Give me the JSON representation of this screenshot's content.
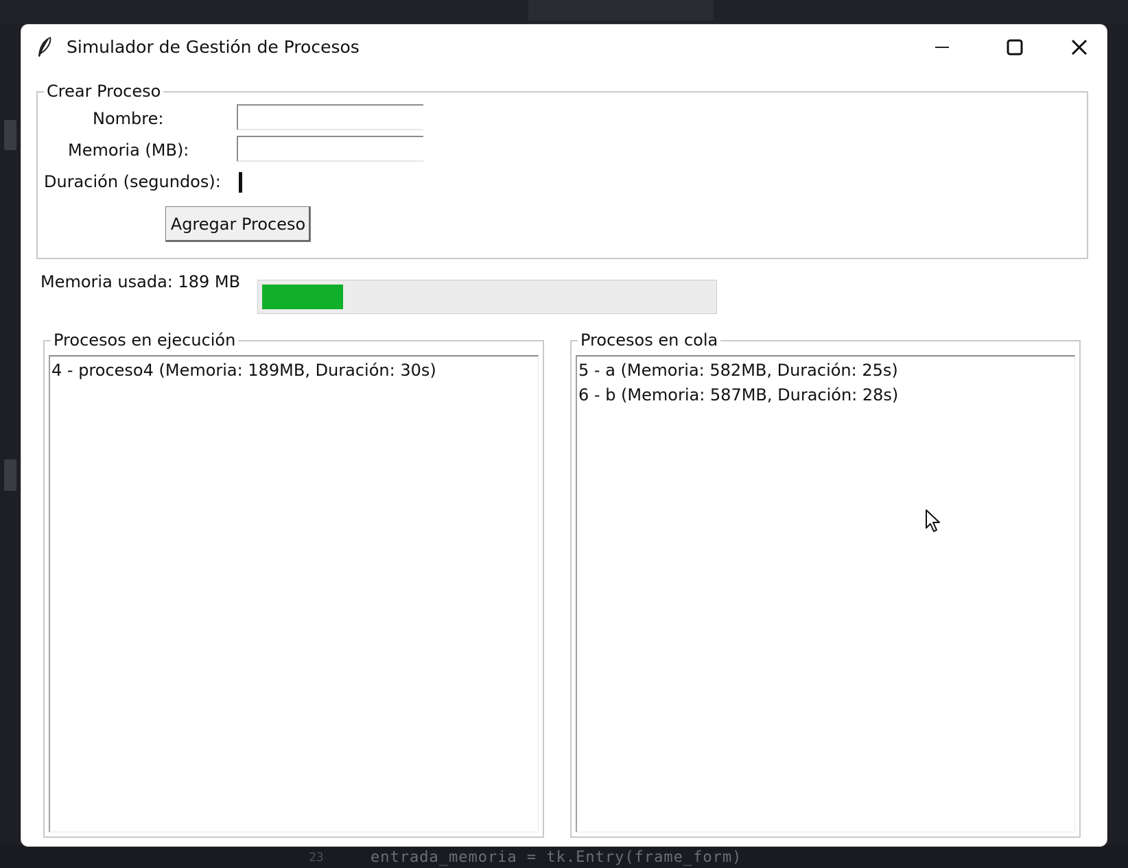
{
  "window": {
    "title": "Simulador de Gestión de Procesos",
    "icon": "feather-icon"
  },
  "form": {
    "frame_title": "Crear Proceso",
    "nombre_label": "Nombre:",
    "nombre_value": "",
    "memoria_label": "Memoria (MB):",
    "memoria_value": "",
    "duracion_label": "Duración (segundos):",
    "duracion_value": "",
    "add_button_label": "Agregar Proceso"
  },
  "memory": {
    "label": "Memoria usada: 189 MB",
    "used_mb": 189,
    "bar_fill_fraction": 0.18,
    "bar_color": "#10b02a"
  },
  "running": {
    "frame_title": "Procesos en ejecución",
    "items": [
      "4 - proceso4 (Memoria: 189MB, Duración: 30s)"
    ]
  },
  "queue": {
    "frame_title": "Procesos en cola",
    "items": [
      "5 - a (Memoria: 582MB, Duración: 25s)",
      "6 - b (Memoria: 587MB, Duración: 28s)"
    ]
  },
  "background": {
    "code_line": "entrada_memoria = tk.Entry(frame_form)",
    "line_number": "23"
  }
}
